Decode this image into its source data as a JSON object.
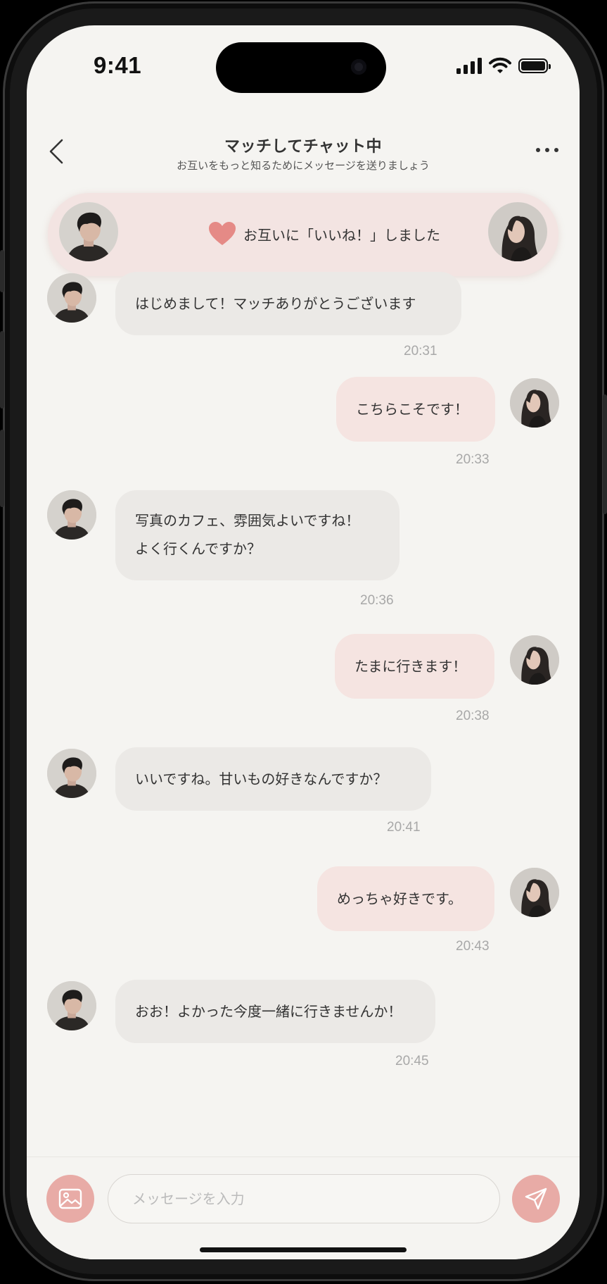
{
  "status_bar": {
    "time": "9:41"
  },
  "header": {
    "title": "マッチしてチャット中",
    "subtitle": "お互いをもっと知るためにメッセージを送りましょう"
  },
  "match_banner": {
    "text": "お互いに「いいね！」しました"
  },
  "messages": [
    {
      "side": "in",
      "lines": [
        "はじめまして！マッチありがとうございます"
      ],
      "time": "20:31"
    },
    {
      "side": "out",
      "lines": [
        "こちらこそです！"
      ],
      "time": "20:33"
    },
    {
      "side": "in",
      "lines": [
        "写真のカフェ、雰囲気よいですね！",
        "よく行くんですか？"
      ],
      "time": "20:36"
    },
    {
      "side": "out",
      "lines": [
        "たまに行きます！"
      ],
      "time": "20:38"
    },
    {
      "side": "in",
      "lines": [
        "いいですね。甘いもの好きなんですか？"
      ],
      "time": "20:41"
    },
    {
      "side": "out",
      "lines": [
        "めっちゃ好きです。"
      ],
      "time": "20:43"
    },
    {
      "side": "in",
      "lines": [
        "おお！よかった今度一緒に行きませんか！"
      ],
      "time": "20:45"
    }
  ],
  "input": {
    "placeholder": "メッセージを入力",
    "value": ""
  },
  "icons": {
    "back": "chevron-left-icon",
    "more": "more-horizontal-icon",
    "heart": "heart-icon",
    "image": "image-icon",
    "send": "send-icon"
  },
  "colors": {
    "background": "#f5f4f1",
    "incoming_bubble": "#ebe9e6",
    "outgoing_bubble": "#f5e4e1",
    "accent": "#e8aba6",
    "heart": "#e58a86",
    "banner": "#f3e4e2"
  }
}
